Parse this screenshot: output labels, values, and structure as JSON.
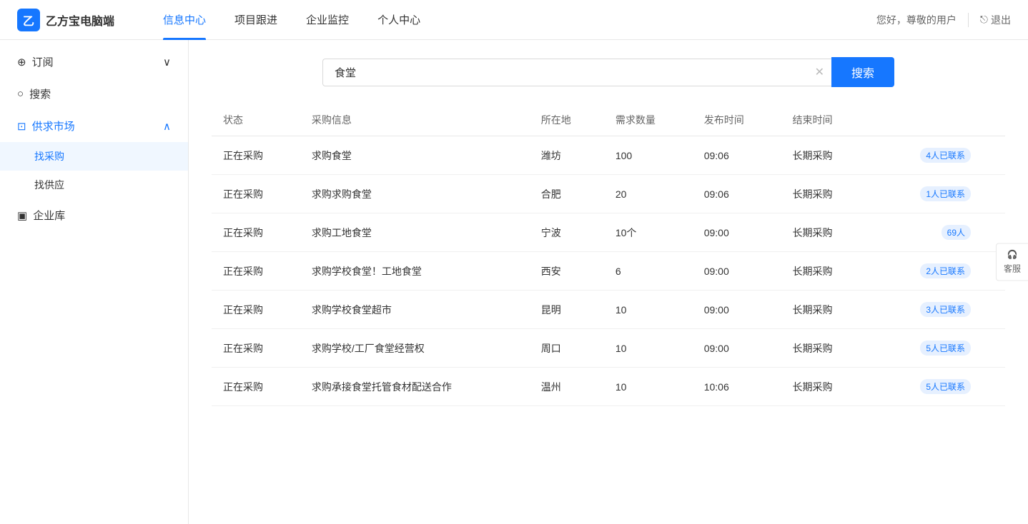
{
  "app": {
    "logo_icon": "乙",
    "logo_text": "乙方宝电脑端"
  },
  "header": {
    "nav_items": [
      {
        "label": "信息中心",
        "active": true
      },
      {
        "label": "项目跟进",
        "active": false
      },
      {
        "label": "企业监控",
        "active": false
      },
      {
        "label": "个人中心",
        "active": false
      }
    ],
    "user_greeting": "您好，尊敬的用户",
    "logout_label": "退出"
  },
  "sidebar": {
    "items": [
      {
        "label": "订阅",
        "icon": "bookmark",
        "has_arrow": true,
        "expanded": false
      },
      {
        "label": "搜索",
        "icon": "search",
        "has_arrow": false
      },
      {
        "label": "供求市场",
        "icon": "market",
        "has_arrow": true,
        "expanded": true,
        "active": true,
        "sub_items": [
          {
            "label": "找采购",
            "active": true
          },
          {
            "label": "找供应",
            "active": false
          }
        ]
      },
      {
        "label": "企业库",
        "icon": "building",
        "has_arrow": false
      }
    ]
  },
  "search": {
    "value": "食堂",
    "placeholder": "搜索",
    "button_label": "搜索"
  },
  "table": {
    "columns": [
      "状态",
      "采购信息",
      "所在地",
      "需求数量",
      "发布时间",
      "结束时间"
    ],
    "rows": [
      {
        "status": "正在采购",
        "info": "求购食堂",
        "location": "潍坊",
        "quantity": "100",
        "publish_time": "09:06",
        "end_time": "长期采购",
        "contacts": "4人已联系"
      },
      {
        "status": "正在采购",
        "info": "求购求购食堂",
        "location": "合肥",
        "quantity": "20",
        "publish_time": "09:06",
        "end_time": "长期采购",
        "contacts": "1人已联系"
      },
      {
        "status": "正在采购",
        "info": "求购工地食堂",
        "location": "宁波",
        "quantity": "10个",
        "publish_time": "09:00",
        "end_time": "长期采购",
        "contacts": "69人"
      },
      {
        "status": "正在采购",
        "info": "求购学校食堂！工地食堂",
        "location": "西安",
        "quantity": "6",
        "publish_time": "09:00",
        "end_time": "长期采购",
        "contacts": "2人已联系"
      },
      {
        "status": "正在采购",
        "info": "求购学校食堂超市",
        "location": "昆明",
        "quantity": "10",
        "publish_time": "09:00",
        "end_time": "长期采购",
        "contacts": "3人已联系"
      },
      {
        "status": "正在采购",
        "info": "求购学校/工厂食堂经营权",
        "location": "周口",
        "quantity": "10",
        "publish_time": "09:00",
        "end_time": "长期采购",
        "contacts": "5人已联系"
      },
      {
        "status": "正在采购",
        "info": "求购承接食堂托管食材配送合作",
        "location": "温州",
        "quantity": "10",
        "publish_time": "10:06",
        "end_time": "长期采购",
        "contacts": "5人已联系"
      }
    ]
  },
  "float_buttons": [
    {
      "label": "客服",
      "icon": "headphone"
    }
  ],
  "icons": {
    "bookmark": "🔖",
    "search": "🔍",
    "market": "🏪",
    "building": "🏢",
    "headphone": "🎧",
    "clear": "✕",
    "logout": "→",
    "arrow_down": "∨",
    "arrow_up": "∧"
  }
}
